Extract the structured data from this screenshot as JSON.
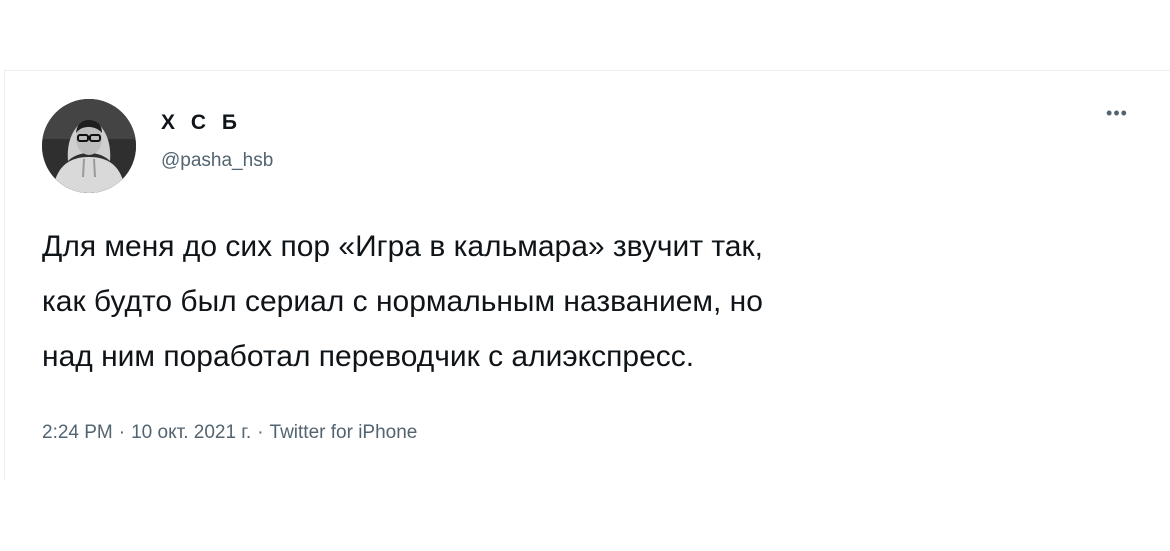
{
  "tweet": {
    "author": {
      "display_name": "Х С Б",
      "handle": "@pasha_hsb"
    },
    "more_icon": "more-dots-icon",
    "text_lines": [
      "Для меня до сих пор «Игра в кальмара» звучит так,",
      "как будто был сериал с нормальным названием, но",
      "над ним поработал переводчик с алиэкспресс."
    ],
    "meta": {
      "time": "2:24 PM",
      "separator": "·",
      "date": "10 окт. 2021 г.",
      "source": "Twitter for iPhone"
    }
  },
  "colors": {
    "text_primary": "#0f1419",
    "text_secondary": "#536471",
    "border": "#eceff1"
  }
}
